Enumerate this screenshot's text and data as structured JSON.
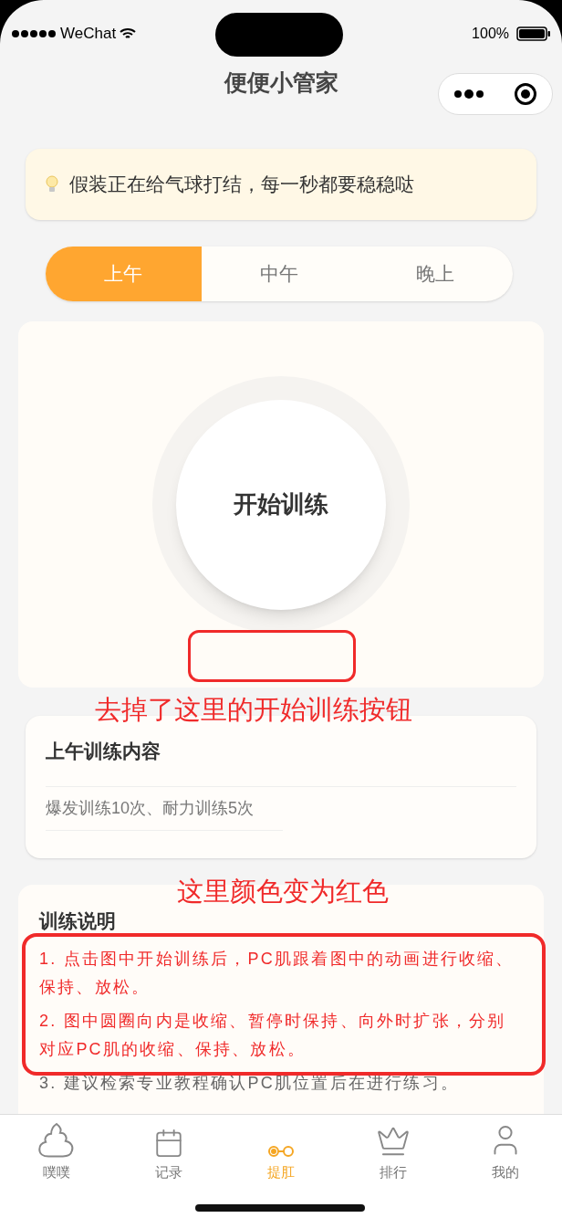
{
  "status_bar": {
    "carrier": "WeChat",
    "battery": "100%"
  },
  "nav": {
    "title": "便便小管家"
  },
  "tip": {
    "text": "假装正在给气球打结，每一秒都要稳稳哒"
  },
  "tabs": [
    {
      "label": "上午",
      "selected": true
    },
    {
      "label": "中午",
      "selected": false
    },
    {
      "label": "晚上",
      "selected": false
    }
  ],
  "trainer": {
    "button": "开始训练"
  },
  "content_card": {
    "title": "上午训练内容",
    "text": "爆发训练10次、耐力训练5次"
  },
  "instructions": {
    "title": "训练说明",
    "items": [
      {
        "text": "1. 点击图中开始训练后，PC肌跟着图中的动画进行收缩、保持、放松。",
        "color": "#f02a2a"
      },
      {
        "text": "2. 图中圆圈向内是收缩、暂停时保持、向外时扩张，分别对应PC肌的收缩、保持、放松。",
        "color": "#f02a2a"
      },
      {
        "text": "3. 建议检索专业教程确认PC肌位置后在进行练习。",
        "color": "#666666"
      }
    ]
  },
  "tab_bar": [
    {
      "label": "噗噗",
      "kind": "poop",
      "selected": false
    },
    {
      "label": "记录",
      "kind": "calendar",
      "selected": false
    },
    {
      "label": "提肛",
      "kind": "link",
      "selected": true
    },
    {
      "label": "排行",
      "kind": "crown",
      "selected": false
    },
    {
      "label": "我的",
      "kind": "user",
      "selected": false
    }
  ],
  "annotations": [
    {
      "text": "去掉了这里的开始训练按钮"
    },
    {
      "text": "这里颜色变为红色"
    }
  ]
}
